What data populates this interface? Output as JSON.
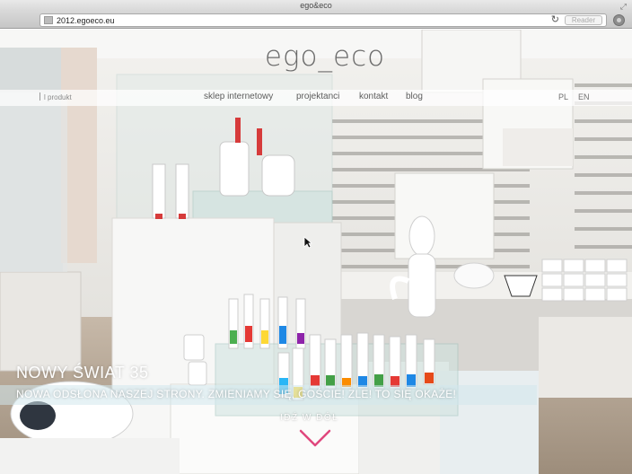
{
  "window": {
    "title": "ego&eco"
  },
  "toolbar": {
    "url": "2012.egoeco.eu",
    "reader_label": "Reader"
  },
  "site": {
    "logo": "ego_eco",
    "nav_left": "l produkt",
    "nav": [
      "sklep internetowy",
      "projektanci",
      "kontakt",
      "blog"
    ],
    "languages": [
      "PL",
      "EN"
    ]
  },
  "hero": {
    "title": "NOWY ŚWIAT 35",
    "subtitle": "NOWA ODSŁONA NASZEJ STRONY. ZMIENIAMY SIĘ, GOŚCIE! ZLE! TO SIĘ OKAŻE!",
    "cta": "IDŹ W DÓŁ"
  },
  "colors": {
    "accent_pink": "#e0477d",
    "band": "#d2e8ec"
  },
  "icons": [
    "resize-icon",
    "favicon-icon",
    "reload-icon",
    "downloads-icon",
    "chevron-down-icon",
    "cursor-icon"
  ]
}
